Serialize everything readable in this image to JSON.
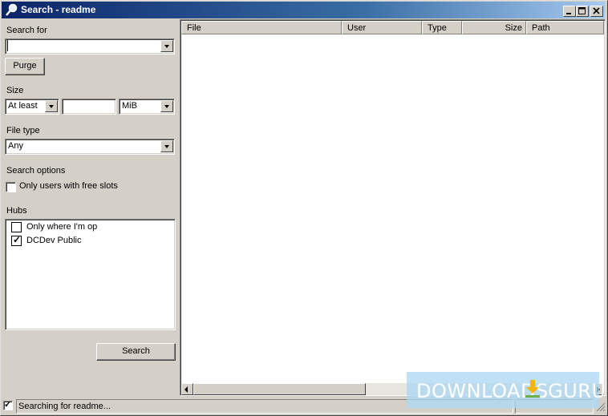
{
  "window": {
    "title": "Search - readme",
    "icon": "search-magnifier-icon",
    "controls": [
      "minimize-icon",
      "maximize-icon",
      "close-icon"
    ]
  },
  "search": {
    "label": "Search for",
    "value": "",
    "purge_label": "Purge"
  },
  "size": {
    "label": "Size",
    "mode": "At least",
    "value": "",
    "unit": "MiB"
  },
  "file_type": {
    "label": "File type",
    "value": "Any"
  },
  "search_options": {
    "label": "Search options",
    "free_slots_label": "Only users with free slots",
    "free_slots_checked": false
  },
  "hubs": {
    "label": "Hubs",
    "items": [
      {
        "label": "Only where I'm op",
        "checked": false
      },
      {
        "label": "DCDev Public",
        "checked": true
      }
    ]
  },
  "search_button": "Search",
  "results": {
    "columns": [
      "File",
      "User",
      "Type",
      "Size",
      "Path"
    ],
    "rows": []
  },
  "status": {
    "checkbox_checked": true,
    "text": "Searching for readme..."
  },
  "watermark": {
    "text_left": "DOWNLOADS",
    "text_right": ".GURU",
    "icon": "download-arrow-icon"
  },
  "colors": {
    "title_start": "#0a246a",
    "title_end": "#a6caf0",
    "face": "#d4d0c8",
    "watermark": "#add7f2"
  }
}
